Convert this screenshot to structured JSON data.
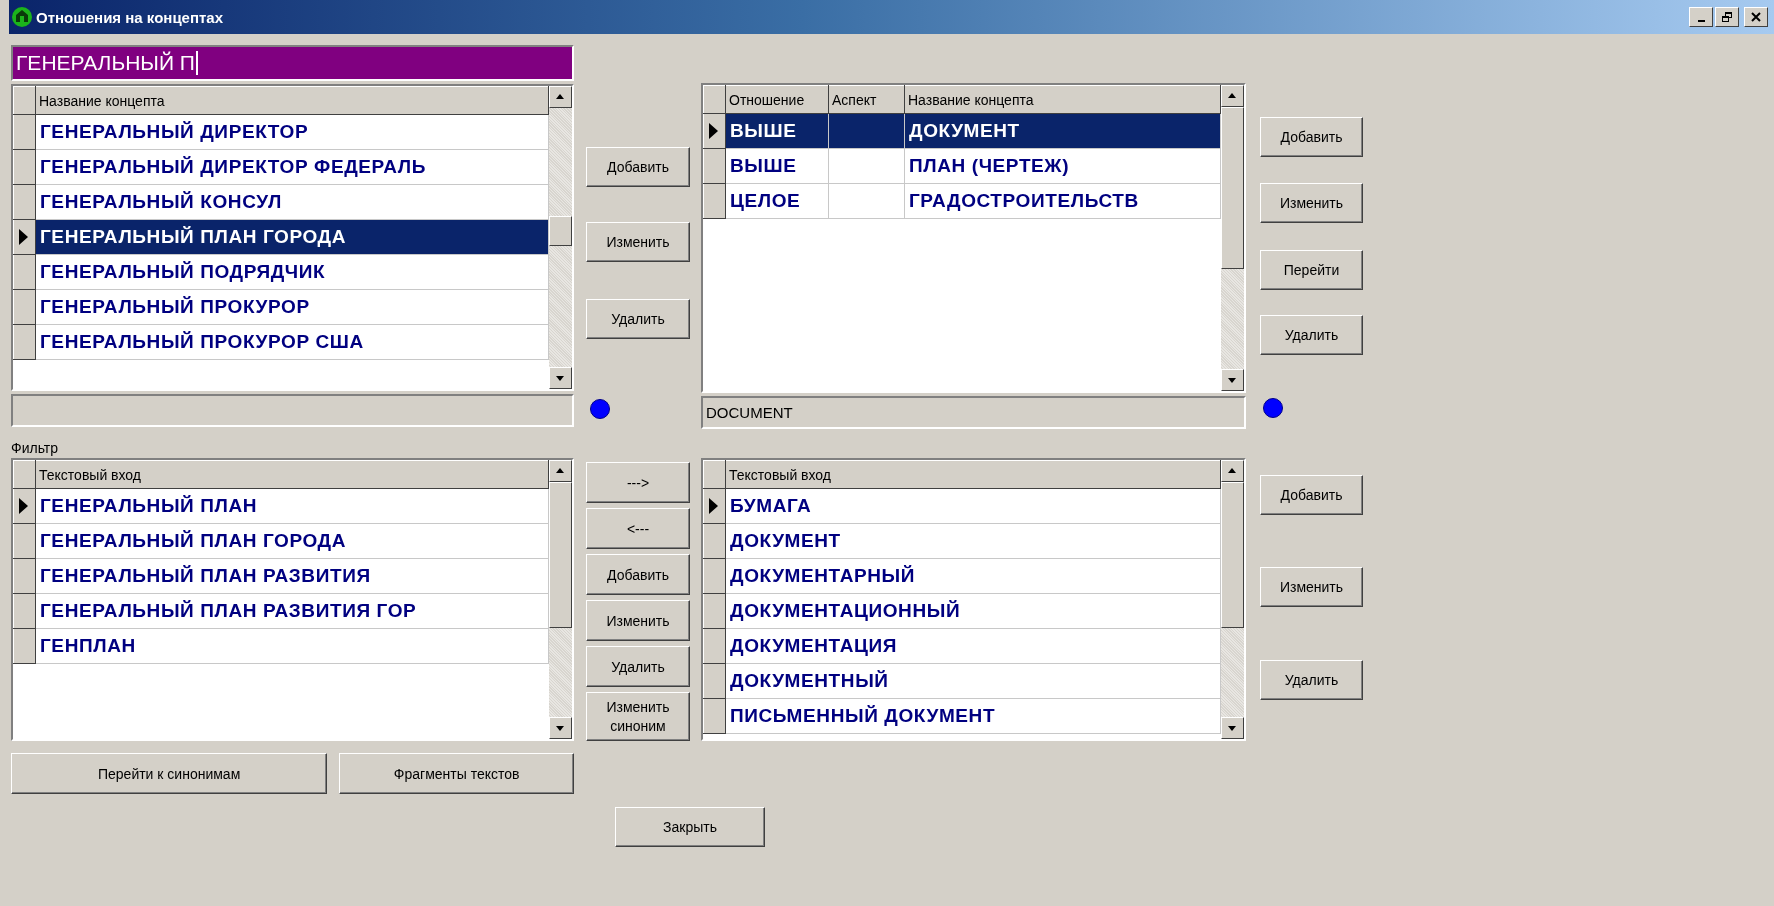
{
  "window": {
    "title": "Отношения на концептах"
  },
  "search_field": {
    "value": "ГЕНЕРАЛЬНЫЙ П"
  },
  "concepts_grid": {
    "columns": [
      "Название концепта"
    ],
    "rows": [
      {
        "text": "ГЕНЕРАЛЬНЫЙ ДИРЕКТОР",
        "current": false,
        "selected": false
      },
      {
        "text": "ГЕНЕРАЛЬНЫЙ ДИРЕКТОР ФЕДЕРАЛЬ",
        "current": false,
        "selected": false
      },
      {
        "text": "ГЕНЕРАЛЬНЫЙ КОНСУЛ",
        "current": false,
        "selected": false
      },
      {
        "text": "ГЕНЕРАЛЬНЫЙ ПЛАН ГОРОДА",
        "current": true,
        "selected": true
      },
      {
        "text": "ГЕНЕРАЛЬНЫЙ ПОДРЯДЧИК",
        "current": false,
        "selected": false
      },
      {
        "text": "ГЕНЕРАЛЬНЫЙ ПРОКУРОР",
        "current": false,
        "selected": false
      },
      {
        "text": "ГЕНЕРАЛЬНЫЙ ПРОКУРОР США",
        "current": false,
        "selected": false
      }
    ]
  },
  "concept_buttons": [
    "Добавить",
    "Изменить",
    "Удалить"
  ],
  "relations_grid": {
    "columns": [
      "Отношение",
      "Аспект",
      "Название концепта"
    ],
    "rows": [
      {
        "relation": "ВЫШЕ",
        "concept": "ДОКУМЕНТ",
        "current": true,
        "selected": true
      },
      {
        "relation": "ВЫШЕ",
        "concept": "ПЛАН (ЧЕРТЕЖ)",
        "current": false,
        "selected": false
      },
      {
        "relation": "ЦЕЛОЕ",
        "concept": "ГРАДОСТРОИТЕЛЬСТВ",
        "current": false,
        "selected": false
      }
    ]
  },
  "relation_buttons": [
    "Добавить",
    "Изменить",
    "Перейти",
    "Удалить"
  ],
  "english_field": {
    "value": "DOCUMENT"
  },
  "filter_label": "Фильтр",
  "entries_grid": {
    "columns": [
      "Текстовый вход"
    ],
    "rows": [
      {
        "text": "ГЕНЕРАЛЬНЫЙ ПЛАН",
        "current": true,
        "selected": false
      },
      {
        "text": "ГЕНЕРАЛЬНЫЙ ПЛАН ГОРОДА",
        "current": false,
        "selected": false
      },
      {
        "text": "ГЕНЕРАЛЬНЫЙ ПЛАН РАЗВИТИЯ",
        "current": false,
        "selected": false
      },
      {
        "text": "ГЕНЕРАЛЬНЫЙ ПЛАН РАЗВИТИЯ ГОР",
        "current": false,
        "selected": false
      },
      {
        "text": "ГЕНПЛАН",
        "current": false,
        "selected": false
      }
    ]
  },
  "transfer_buttons": [
    "--->",
    "<---",
    "Добавить",
    "Изменить",
    "Удалить",
    "Изменить синоним"
  ],
  "synonyms_grid": {
    "columns": [
      "Текстовый вход"
    ],
    "rows": [
      {
        "text": "БУМАГА",
        "current": true,
        "selected": false
      },
      {
        "text": "ДОКУМЕНТ",
        "current": false,
        "selected": false
      },
      {
        "text": "ДОКУМЕНТАРНЫЙ",
        "current": false,
        "selected": false
      },
      {
        "text": "ДОКУМЕНТАЦИОННЫЙ",
        "current": false,
        "selected": false
      },
      {
        "text": "ДОКУМЕНТАЦИЯ",
        "current": false,
        "selected": false
      },
      {
        "text": "ДОКУМЕНТНЫЙ",
        "current": false,
        "selected": false
      },
      {
        "text": "ПИСЬМЕННЫЙ ДОКУМЕНТ",
        "current": false,
        "selected": false
      }
    ]
  },
  "synonym_buttons": [
    "Добавить",
    "Изменить",
    "Удалить"
  ],
  "bottom_buttons": [
    "Перейти к синонимам",
    "Фрагменты текстов"
  ],
  "close_button": "Закрыть"
}
